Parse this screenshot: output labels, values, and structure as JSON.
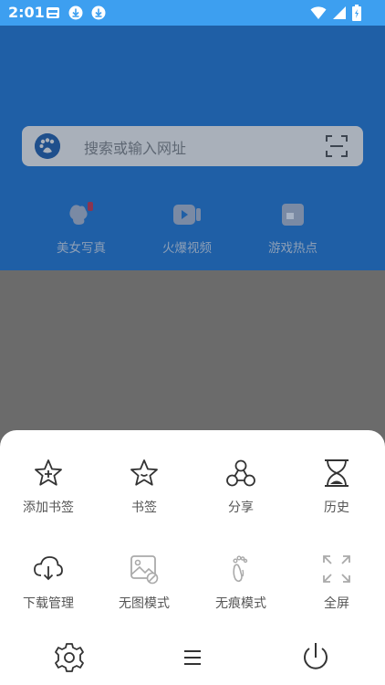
{
  "status_bar": {
    "time": "2:01"
  },
  "search": {
    "placeholder": "搜索或输入网址"
  },
  "quick_links": [
    {
      "label": "美女写真"
    },
    {
      "label": "火爆视频"
    },
    {
      "label": "游戏热点"
    }
  ],
  "menu": {
    "row1": [
      {
        "label": "添加书签",
        "icon": "star-plus-icon"
      },
      {
        "label": "书签",
        "icon": "star-icon"
      },
      {
        "label": "分享",
        "icon": "share-icon"
      },
      {
        "label": "历史",
        "icon": "hourglass-icon"
      }
    ],
    "row2": [
      {
        "label": "下载管理",
        "icon": "cloud-download-icon"
      },
      {
        "label": "无图模式",
        "icon": "no-image-icon"
      },
      {
        "label": "无痕模式",
        "icon": "footprint-icon"
      },
      {
        "label": "全屏",
        "icon": "fullscreen-icon"
      }
    ]
  },
  "colors": {
    "status_bar": "#3d9ff0",
    "header_dim": "#1f5fa6",
    "overlay": "#6b6b6b",
    "sheet": "#ffffff"
  }
}
